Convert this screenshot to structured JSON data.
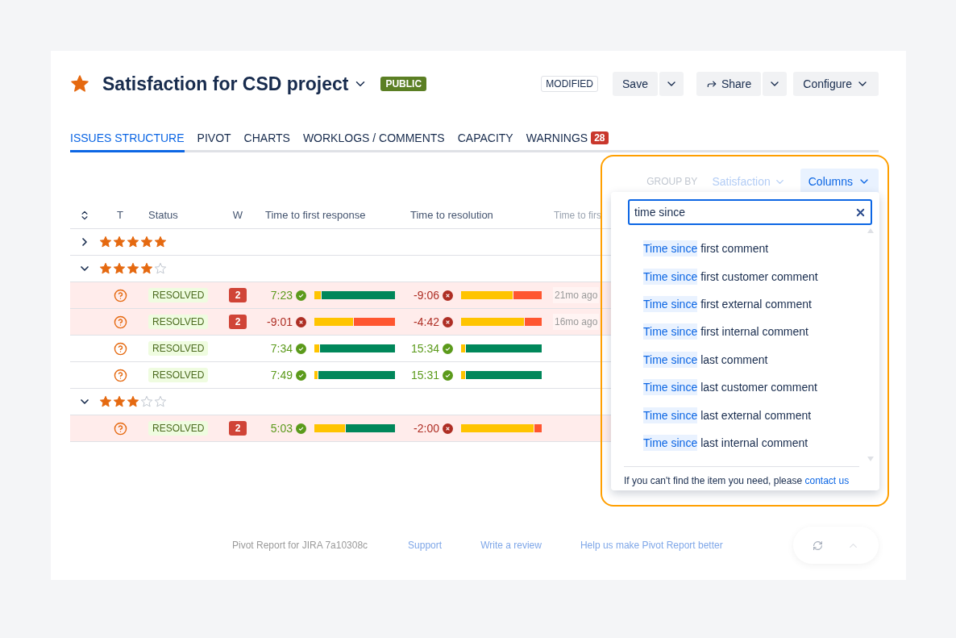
{
  "header": {
    "starred": true,
    "title": "Satisfaction for CSD project",
    "visibility": "PUBLIC",
    "state": "MODIFIED",
    "buttons": {
      "save": "Save",
      "share": "Share",
      "configure": "Configure"
    }
  },
  "tabs": [
    {
      "label": "ISSUES STRUCTURE",
      "selected": true
    },
    {
      "label": "PIVOT",
      "selected": false
    },
    {
      "label": "CHARTS",
      "selected": false
    },
    {
      "label": "WORKLOGS / COMMENTS",
      "selected": false
    },
    {
      "label": "CAPACITY",
      "selected": false
    },
    {
      "label": "WARNINGS",
      "selected": false,
      "count": "28"
    }
  ],
  "toolbar": {
    "group_by_label": "GROUP BY",
    "group_by_value": "Satisfaction",
    "columns_button": "Columns"
  },
  "table": {
    "columns": [
      "T",
      "Status",
      "W",
      "Time to first response",
      "Time to resolution",
      "Time to firs"
    ],
    "groups": [
      {
        "stars": 5,
        "expanded": false
      },
      {
        "stars": 4,
        "expanded": true,
        "rows": [
          {
            "highlighted": true,
            "status": "RESOLVED",
            "warnings": "2",
            "first_response": {
              "time": "7:23",
              "met": true,
              "level": 0.08
            },
            "resolution": {
              "time": "-9:06",
              "met": false,
              "level": 0.64
            },
            "since": "21mo ago"
          },
          {
            "highlighted": true,
            "status": "RESOLVED",
            "warnings": "2",
            "first_response": {
              "time": "-9:01",
              "met": false,
              "level": 0.48
            },
            "resolution": {
              "time": "-4:42",
              "met": false,
              "level": 0.78
            },
            "since": "16mo ago"
          },
          {
            "highlighted": false,
            "status": "RESOLVED",
            "first_response": {
              "time": "7:34",
              "met": true,
              "level": 0.06
            },
            "resolution": {
              "time": "15:34",
              "met": true,
              "level": 0.05
            }
          },
          {
            "highlighted": false,
            "status": "RESOLVED",
            "first_response": {
              "time": "7:49",
              "met": true,
              "level": 0.04
            },
            "resolution": {
              "time": "15:31",
              "met": true,
              "level": 0.05
            }
          }
        ]
      },
      {
        "stars": 3,
        "expanded": true,
        "rows": [
          {
            "highlighted": true,
            "status": "RESOLVED",
            "warnings": "2",
            "first_response": {
              "time": "5:03",
              "met": true,
              "level": 0.38
            },
            "resolution": {
              "time": "-2:00",
              "met": false,
              "level": 0.9
            }
          }
        ]
      }
    ]
  },
  "columns_menu": {
    "search_value": "time since",
    "items": [
      {
        "match": "Time since",
        "rest": "first comment"
      },
      {
        "match": "Time since",
        "rest": "first customer comment"
      },
      {
        "match": "Time since",
        "rest": "first external comment"
      },
      {
        "match": "Time since",
        "rest": "first internal comment"
      },
      {
        "match": "Time since",
        "rest": "last comment"
      },
      {
        "match": "Time since",
        "rest": "last customer comment"
      },
      {
        "match": "Time since",
        "rest": "last external comment"
      },
      {
        "match": "Time since",
        "rest": "last internal comment"
      }
    ],
    "note": "If you can't find the item you need, please",
    "note_link": "contact us"
  },
  "footer": {
    "version": "Pivot Report for JIRA 7a10308c",
    "links": [
      "Support",
      "Write a review",
      "Help us make Pivot Report better"
    ]
  }
}
